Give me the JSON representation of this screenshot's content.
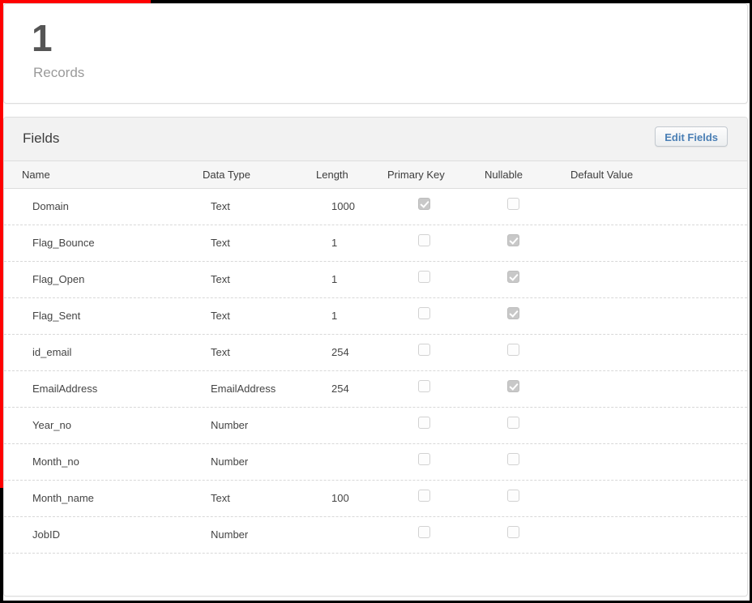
{
  "accents": {
    "top_bar": "#fe0000",
    "frame": "#000000",
    "button_text": "#4a7fb5"
  },
  "summary_card": {
    "value": "1",
    "label": "Records"
  },
  "fields_panel": {
    "title": "Fields",
    "edit_button": "Edit Fields",
    "columns": {
      "name": "Name",
      "data_type": "Data Type",
      "length": "Length",
      "primary_key": "Primary Key",
      "nullable": "Nullable",
      "default_value": "Default Value"
    },
    "rows": [
      {
        "name": "Domain",
        "data_type": "Text",
        "length": "1000",
        "primary_key": true,
        "nullable": false,
        "default_value": ""
      },
      {
        "name": "Flag_Bounce",
        "data_type": "Text",
        "length": "1",
        "primary_key": false,
        "nullable": true,
        "default_value": ""
      },
      {
        "name": "Flag_Open",
        "data_type": "Text",
        "length": "1",
        "primary_key": false,
        "nullable": true,
        "default_value": ""
      },
      {
        "name": "Flag_Sent",
        "data_type": "Text",
        "length": "1",
        "primary_key": false,
        "nullable": true,
        "default_value": ""
      },
      {
        "name": "id_email",
        "data_type": "Text",
        "length": "254",
        "primary_key": false,
        "nullable": false,
        "default_value": ""
      },
      {
        "name": "EmailAddress",
        "data_type": "EmailAddress",
        "length": "254",
        "primary_key": false,
        "nullable": true,
        "default_value": ""
      },
      {
        "name": "Year_no",
        "data_type": "Number",
        "length": "",
        "primary_key": false,
        "nullable": false,
        "default_value": ""
      },
      {
        "name": "Month_no",
        "data_type": "Number",
        "length": "",
        "primary_key": false,
        "nullable": false,
        "default_value": ""
      },
      {
        "name": "Month_name",
        "data_type": "Text",
        "length": "100",
        "primary_key": false,
        "nullable": false,
        "default_value": ""
      },
      {
        "name": "JobID",
        "data_type": "Number",
        "length": "",
        "primary_key": false,
        "nullable": false,
        "default_value": ""
      }
    ]
  }
}
